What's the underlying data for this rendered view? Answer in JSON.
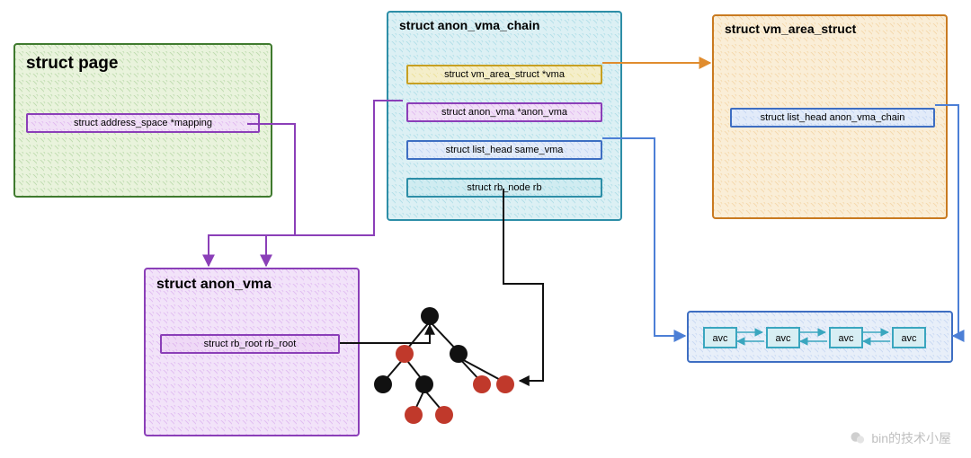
{
  "page": {
    "title": "struct page",
    "field": "struct address_space *mapping"
  },
  "anon_vma": {
    "title": "struct anon_vma",
    "field": "struct rb_root rb_root"
  },
  "avc": {
    "title": "struct anon_vma_chain",
    "fields": {
      "vma": "struct vm_area_struct *vma",
      "anon": "struct anon_vma *anon_vma",
      "same": "struct list_head same_vma",
      "rb": "struct rb_node rb"
    }
  },
  "vmarea": {
    "title": "struct vm_area_struct",
    "field": "struct list_head anon_vma_chain"
  },
  "list": {
    "label": "avc"
  },
  "watermark": "bin的技术小屋",
  "colors": {
    "green": "#6ab04c",
    "purple": "#b45bdc",
    "teal": "#3aa6bf",
    "orange": "#e08c2e",
    "blue": "#4c7fd6",
    "black": "#111",
    "red": "#c0392b"
  }
}
